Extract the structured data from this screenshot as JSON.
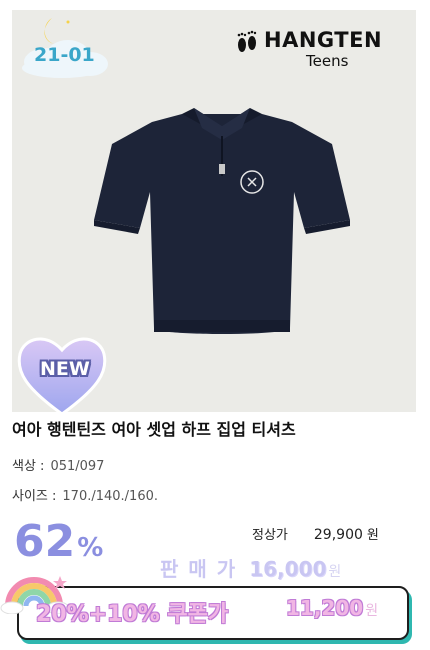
{
  "badge": {
    "code": "21-01"
  },
  "brand": {
    "name": "HANGTEN",
    "sub": "Teens"
  },
  "tag": {
    "new_label": "NEW"
  },
  "product": {
    "title": "여아 행텐틴즈 여아 셋업 하프 집업 티셔츠",
    "color_label": "색상 :",
    "color_value": "051/097",
    "size_label": "사이즈 :",
    "size_value": "170./140./160."
  },
  "pricing": {
    "discount_num": "62",
    "discount_pct": "%",
    "regular_label": "정상가",
    "regular_value": "29,900",
    "regular_won": "원",
    "sale_label": "판매가",
    "sale_value": "16,000",
    "sale_won": "원",
    "coupon_label": "20%+10% 쿠폰가",
    "coupon_value": "11,200",
    "coupon_won": "원"
  },
  "colors": {
    "photo_bg": "#ebebe7",
    "shirt": "#1d2438",
    "discount": "#8b8fe0",
    "coupon_shadow": "#2fb8b0",
    "badge_text": "#3aa6c9"
  },
  "icons": [
    "moon-cloud-icon",
    "hangten-feet-logo",
    "heart-badge-icon",
    "rainbow-icon"
  ]
}
